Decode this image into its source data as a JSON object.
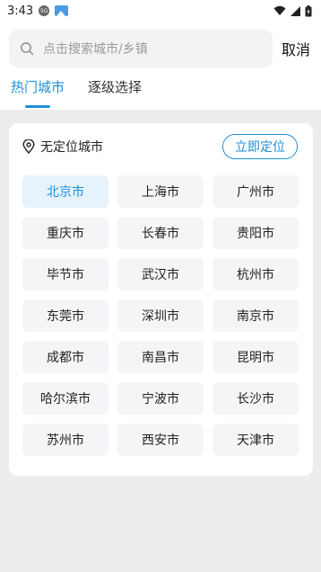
{
  "status_bar": {
    "time": "3:43",
    "sim_label": "5G"
  },
  "search": {
    "placeholder": "点击搜索城市/乡镇",
    "cancel_label": "取消"
  },
  "tabs": [
    {
      "label": "热门城市",
      "active": true
    },
    {
      "label": "逐级选择",
      "active": false
    }
  ],
  "location": {
    "status_text": "无定位城市",
    "locate_button_label": "立即定位"
  },
  "hot_cities": [
    {
      "name": "北京市",
      "selected": true
    },
    {
      "name": "上海市"
    },
    {
      "name": "广州市"
    },
    {
      "name": "重庆市"
    },
    {
      "name": "长春市"
    },
    {
      "name": "贵阳市"
    },
    {
      "name": "毕节市"
    },
    {
      "name": "武汉市"
    },
    {
      "name": "杭州市"
    },
    {
      "name": "东莞市"
    },
    {
      "name": "深圳市"
    },
    {
      "name": "南京市"
    },
    {
      "name": "成都市"
    },
    {
      "name": "南昌市"
    },
    {
      "name": "昆明市"
    },
    {
      "name": "哈尔滨市"
    },
    {
      "name": "宁波市"
    },
    {
      "name": "长沙市"
    },
    {
      "name": "苏州市"
    },
    {
      "name": "西安市"
    },
    {
      "name": "天津市"
    }
  ],
  "colors": {
    "accent": "#1f8fd6",
    "page_bg": "#ededf0",
    "selected_bg": "#e6f2fc"
  }
}
